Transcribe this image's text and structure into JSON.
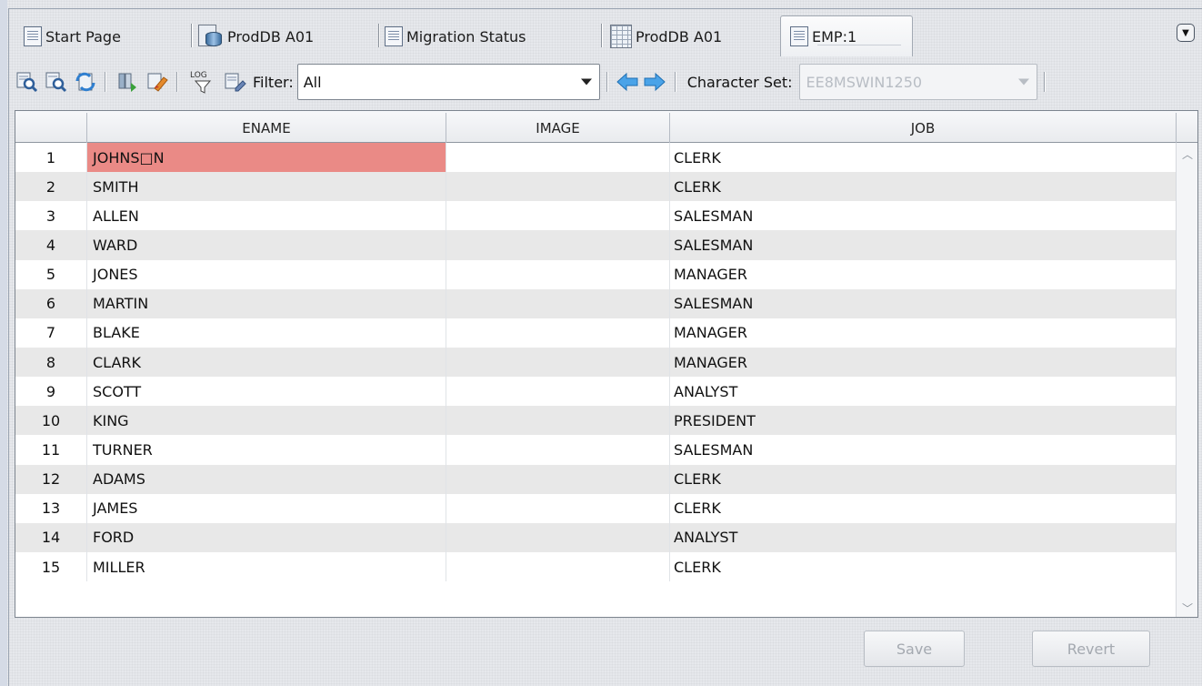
{
  "tabs": [
    {
      "label": "Start Page",
      "icon": "document-icon"
    },
    {
      "label": "ProdDB A01",
      "icon": "database-icon"
    },
    {
      "label": "Migration Status",
      "icon": "document-icon"
    },
    {
      "label": "ProdDB A01",
      "icon": "grid-icon"
    },
    {
      "label": "EMP:1",
      "icon": "document-icon",
      "active": true
    }
  ],
  "toolbar": {
    "log_label": "LOG",
    "filter_label": "Filter:",
    "filter_value": "All",
    "charset_label": "Character Set:",
    "charset_value": "EE8MSWIN1250"
  },
  "table": {
    "columns": [
      "",
      "ENAME",
      "IMAGE",
      "JOB"
    ],
    "rows": [
      {
        "num": "1",
        "ename": "JOHNS□N",
        "image": "",
        "job": "CLERK",
        "error": true
      },
      {
        "num": "2",
        "ename": "SMITH",
        "image": "",
        "job": "CLERK"
      },
      {
        "num": "3",
        "ename": "ALLEN",
        "image": "",
        "job": "SALESMAN"
      },
      {
        "num": "4",
        "ename": "WARD",
        "image": "",
        "job": "SALESMAN"
      },
      {
        "num": "5",
        "ename": "JONES",
        "image": "",
        "job": "MANAGER"
      },
      {
        "num": "6",
        "ename": "MARTIN",
        "image": "",
        "job": "SALESMAN"
      },
      {
        "num": "7",
        "ename": "BLAKE",
        "image": "",
        "job": "MANAGER"
      },
      {
        "num": "8",
        "ename": "CLARK",
        "image": "",
        "job": "MANAGER"
      },
      {
        "num": "9",
        "ename": "SCOTT",
        "image": "",
        "job": "ANALYST"
      },
      {
        "num": "10",
        "ename": "KING",
        "image": "",
        "job": "PRESIDENT"
      },
      {
        "num": "11",
        "ename": "TURNER",
        "image": "",
        "job": "SALESMAN"
      },
      {
        "num": "12",
        "ename": "ADAMS",
        "image": "",
        "job": "CLERK"
      },
      {
        "num": "13",
        "ename": "JAMES",
        "image": "",
        "job": "CLERK"
      },
      {
        "num": "14",
        "ename": "FORD",
        "image": "",
        "job": "ANALYST"
      },
      {
        "num": "15",
        "ename": "MILLER",
        "image": "",
        "job": "CLERK"
      }
    ]
  },
  "buttons": {
    "save": "Save",
    "revert": "Revert"
  },
  "colors": {
    "error_cell": "#ea8a86",
    "alt_row": "#e8e8e8"
  }
}
